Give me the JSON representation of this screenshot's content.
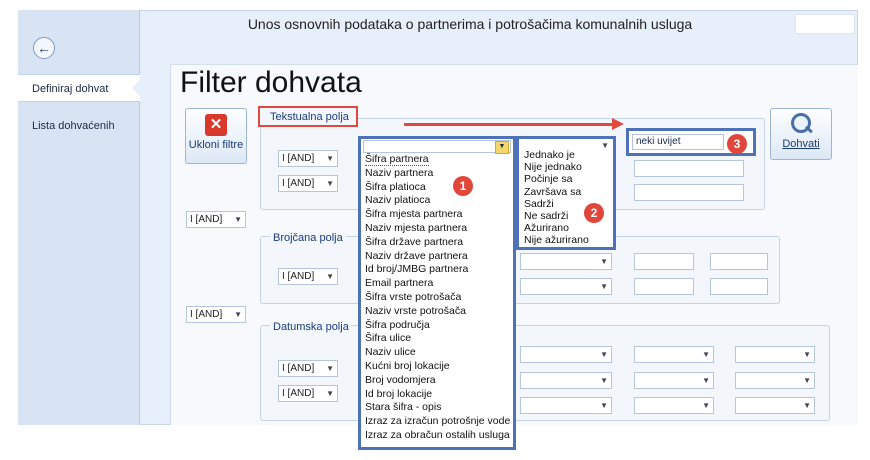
{
  "window": {
    "title": "Unos osnovnih podataka o partnerima i potrošačima komunalnih usluga"
  },
  "sidebar": {
    "back_icon": "arrow-left-icon",
    "items": [
      {
        "label": "Definiraj dohvat",
        "active": true
      },
      {
        "label": "Lista dohvaćenih",
        "active": false
      }
    ]
  },
  "main": {
    "title": "Filter dohvata",
    "remove_button": {
      "label": "Ukloni filtre",
      "icon": "red-x-icon"
    },
    "fetch_button": {
      "label": "Dohvati",
      "icon": "magnifier-icon"
    },
    "groups": {
      "text": "Tekstualna polja",
      "number": "Brojčana polja",
      "date": "Datumska polja"
    },
    "logic_op": "I [AND]",
    "condition_value": "neki uvijet",
    "field_list": [
      "Šifra partnera",
      "Naziv partnera",
      "Šifra platioca",
      "Naziv platioca",
      "Šifra mjesta partnera",
      "Naziv mjesta partnera",
      "Šifra države partnera",
      "Naziv države partnera",
      "Id broj/JMBG partnera",
      "Email partnera",
      "Šifra vrste potrošača",
      "Naziv vrste potrošača",
      "Šifra područja",
      "Šifra ulice",
      "Naziv ulice",
      "Kućni broj lokacije",
      "Broj vodomjera",
      "Id broj lokacije",
      "Stara šifra - opis",
      "Izraz za izračun potrošnje vode",
      "Izraz za obračun ostalih usluga"
    ],
    "operator_list": [
      "Jednako je",
      "Nije jednako",
      "Počinje sa",
      "Završava sa",
      "Sadrži",
      "Ne sadrži",
      "Ažurirano",
      "Nije ažurirano"
    ],
    "badges": [
      "1",
      "2",
      "3"
    ],
    "colors": {
      "accent_blue": "#4e72b8",
      "highlight_red": "#e04a3c"
    }
  }
}
